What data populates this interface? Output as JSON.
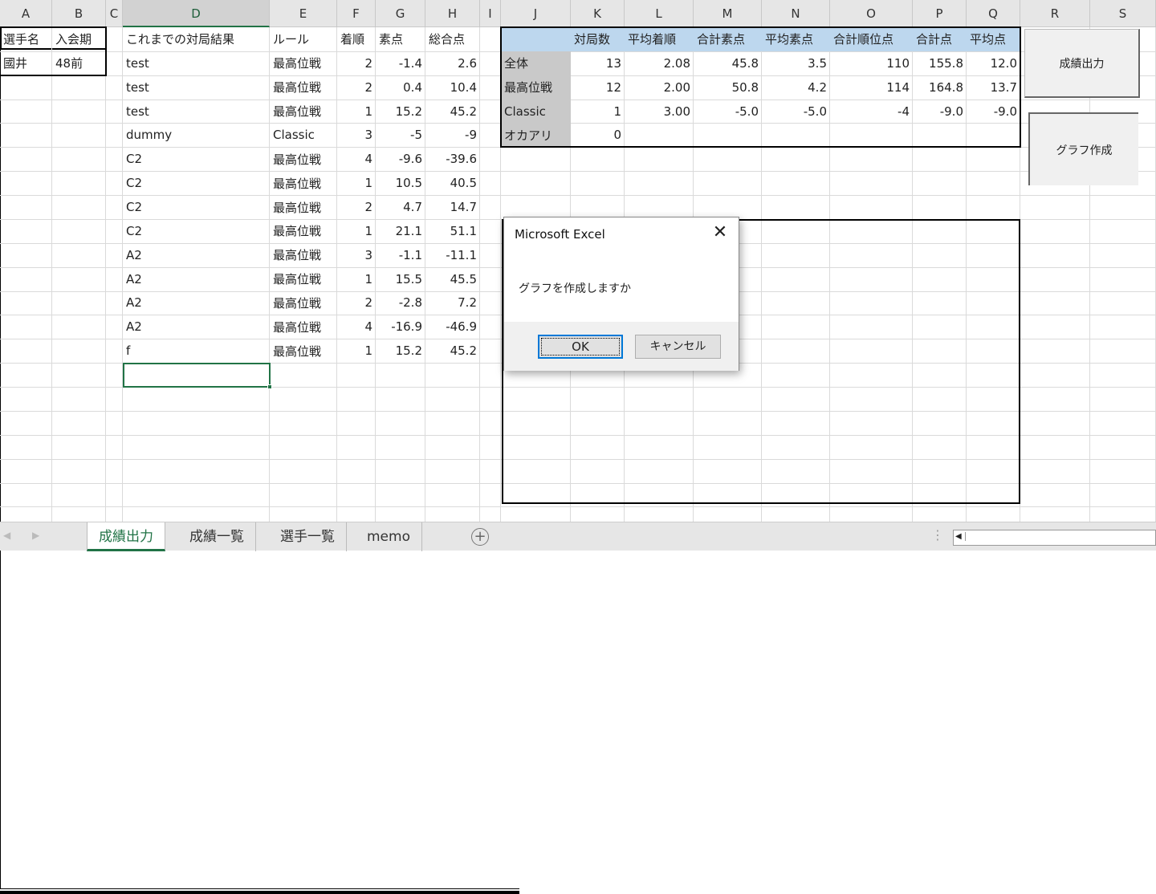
{
  "columns": [
    "A",
    "B",
    "C",
    "D",
    "E",
    "F",
    "G",
    "H",
    "I",
    "J",
    "K",
    "L",
    "M",
    "N",
    "O",
    "P",
    "Q",
    "R",
    "S"
  ],
  "selected_column": "D",
  "player_info": {
    "headers": [
      "選手名",
      "入会期"
    ],
    "row": [
      "國井",
      "48前"
    ]
  },
  "results": {
    "headers": [
      "これまでの対局結果",
      "ルール",
      "着順",
      "素点",
      "総合点"
    ],
    "rows": [
      [
        "test",
        "最高位戦",
        "2",
        "-1.4",
        "2.6"
      ],
      [
        "test",
        "最高位戦",
        "2",
        "0.4",
        "10.4"
      ],
      [
        "test",
        "最高位戦",
        "1",
        "15.2",
        "45.2"
      ],
      [
        "dummy",
        "Classic",
        "3",
        "-5",
        "-9"
      ],
      [
        "C2",
        "最高位戦",
        "4",
        "-9.6",
        "-39.6"
      ],
      [
        "C2",
        "最高位戦",
        "1",
        "10.5",
        "40.5"
      ],
      [
        "C2",
        "最高位戦",
        "2",
        "4.7",
        "14.7"
      ],
      [
        "C2",
        "最高位戦",
        "1",
        "21.1",
        "51.1"
      ],
      [
        "A2",
        "最高位戦",
        "3",
        "-1.1",
        "-11.1"
      ],
      [
        "A2",
        "最高位戦",
        "1",
        "15.5",
        "45.5"
      ],
      [
        "A2",
        "最高位戦",
        "2",
        "-2.8",
        "7.2"
      ],
      [
        "A2",
        "最高位戦",
        "4",
        "-16.9",
        "-46.9"
      ],
      [
        "f",
        "最高位戦",
        "1",
        "15.2",
        "45.2"
      ]
    ]
  },
  "summary": {
    "headers": [
      "対局数",
      "平均着順",
      "合計素点",
      "平均素点",
      "合計順位点",
      "合計点",
      "平均点"
    ],
    "rows": [
      {
        "label": "全体",
        "values": [
          "13",
          "2.08",
          "45.8",
          "3.5",
          "110",
          "155.8",
          "12.0"
        ]
      },
      {
        "label": "最高位戦",
        "values": [
          "12",
          "2.00",
          "50.8",
          "4.2",
          "114",
          "164.8",
          "13.7"
        ]
      },
      {
        "label": "Classic",
        "values": [
          "1",
          "3.00",
          "-5.0",
          "-5.0",
          "-4",
          "-9.0",
          "-9.0"
        ]
      },
      {
        "label": "オカアリ",
        "values": [
          "0",
          "",
          "",
          "",
          "",
          "",
          ""
        ]
      }
    ],
    "header_color": "#BDD7EE",
    "label_color": "#C9C9C9"
  },
  "buttons": {
    "output": "成績出力",
    "graph": "グラフ作成"
  },
  "dialog": {
    "title": "Microsoft Excel",
    "message": "グラフを作成しますか",
    "ok": "OK",
    "cancel": "キャンセル"
  },
  "sheet_tabs": [
    {
      "label": "成績出力",
      "active": true
    },
    {
      "label": "成績一覧"
    },
    {
      "label": "選手一覧"
    },
    {
      "label": "memo"
    }
  ],
  "accent_color": "#217346"
}
